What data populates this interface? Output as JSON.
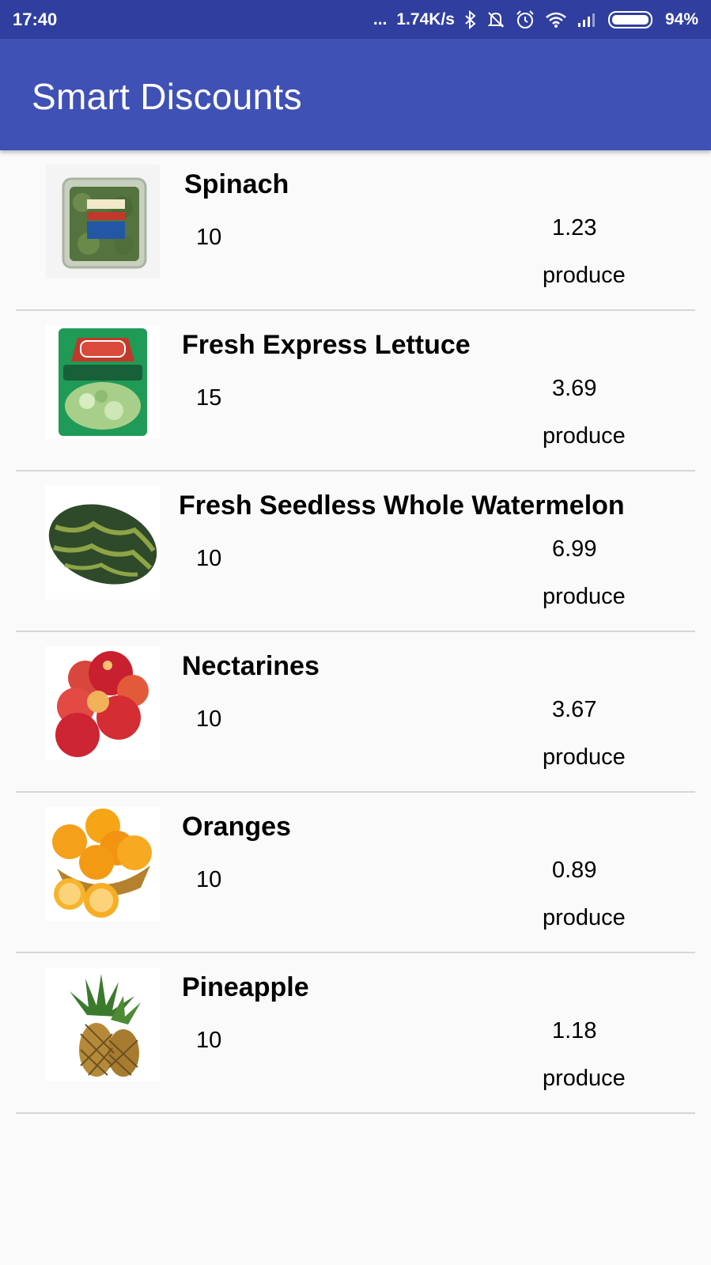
{
  "status_bar": {
    "time": "17:40",
    "dots": "...",
    "net_speed": "1.74K/s",
    "battery": "94%",
    "icons": [
      "bluetooth-icon",
      "mute-bell-icon",
      "alarm-icon",
      "wifi-icon",
      "signal-icon",
      "battery-icon"
    ]
  },
  "app_bar": {
    "title": "Smart Discounts",
    "color": "#3f51b5",
    "status_color": "#303f9f"
  },
  "items": [
    {
      "name": "Spinach",
      "qty": "10",
      "price": "1.23",
      "category": "produce",
      "image": "spinach"
    },
    {
      "name": "Fresh Express Lettuce",
      "qty": "15",
      "price": "3.69",
      "category": "produce",
      "image": "lettuce-bag"
    },
    {
      "name": "Fresh Seedless Whole Watermelon",
      "qty": "10",
      "price": "6.99",
      "category": "produce",
      "image": "watermelon"
    },
    {
      "name": "Nectarines",
      "qty": "10",
      "price": "3.67",
      "category": "produce",
      "image": "nectarines"
    },
    {
      "name": "Oranges",
      "qty": "10",
      "price": "0.89",
      "category": "produce",
      "image": "oranges"
    },
    {
      "name": "Pineapple",
      "qty": "10",
      "price": "1.18",
      "category": "produce",
      "image": "pineapple"
    }
  ]
}
